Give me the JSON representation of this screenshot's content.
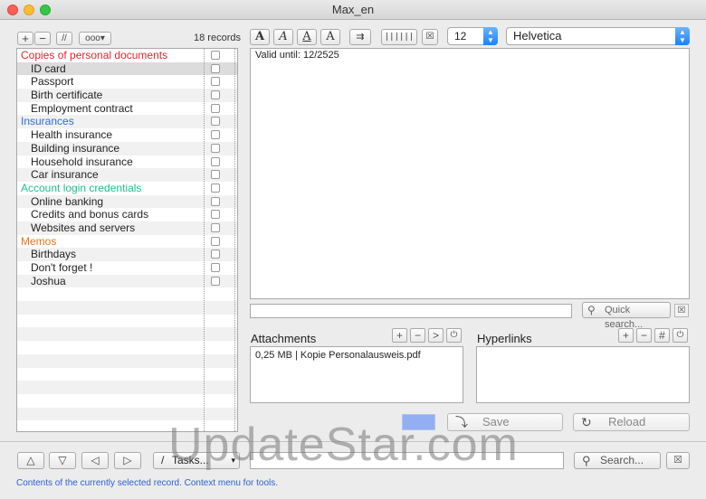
{
  "window": {
    "title": "Max_en"
  },
  "list_toolbar": {
    "add": "+",
    "remove": "−",
    "pause": "//",
    "more": "ooo▾"
  },
  "records_count": "18 records",
  "records": [
    {
      "label": "Copies of personal documents",
      "category": true,
      "color": "#e8262c"
    },
    {
      "label": "ID card",
      "category": false,
      "selected": true
    },
    {
      "label": "Passport",
      "category": false
    },
    {
      "label": "Birth certificate",
      "category": false
    },
    {
      "label": "Employment contract",
      "category": false
    },
    {
      "label": "Insurances",
      "category": true,
      "color": "#2a6fd6"
    },
    {
      "label": "Health insurance",
      "category": false
    },
    {
      "label": "Building insurance",
      "category": false
    },
    {
      "label": "Household insurance",
      "category": false
    },
    {
      "label": "Car insurance",
      "category": false
    },
    {
      "label": "Account login credentials",
      "category": true,
      "color": "#1fbf88"
    },
    {
      "label": "Online banking",
      "category": false
    },
    {
      "label": "Credits and bonus cards",
      "category": false
    },
    {
      "label": "Websites and servers",
      "category": false
    },
    {
      "label": "Memos",
      "category": true,
      "color": "#f0731e"
    },
    {
      "label": "Birthdays",
      "category": false
    },
    {
      "label": "Don't forget !",
      "category": false
    },
    {
      "label": "Joshua",
      "category": false
    }
  ],
  "format_toolbar": {
    "bold": "A",
    "italic": "A",
    "underline": "A",
    "plain": "A",
    "font_size": "12",
    "font_family": "Helvetica"
  },
  "editor": {
    "content": "Valid until: 12/2525"
  },
  "quick_search": {
    "label": "Quick search..."
  },
  "attachments": {
    "title": "Attachments",
    "items": [
      "0,25 MB | Kopie Personalausweis.pdf"
    ]
  },
  "hyperlinks": {
    "title": "Hyperlinks"
  },
  "actions": {
    "save": "Save",
    "reload": "Reload"
  },
  "bottom": {
    "tasks": "Tasks...",
    "search": "Search...",
    "status": "Contents of the currently selected record. Context menu for tools."
  },
  "watermark": "UpdateStar.com"
}
